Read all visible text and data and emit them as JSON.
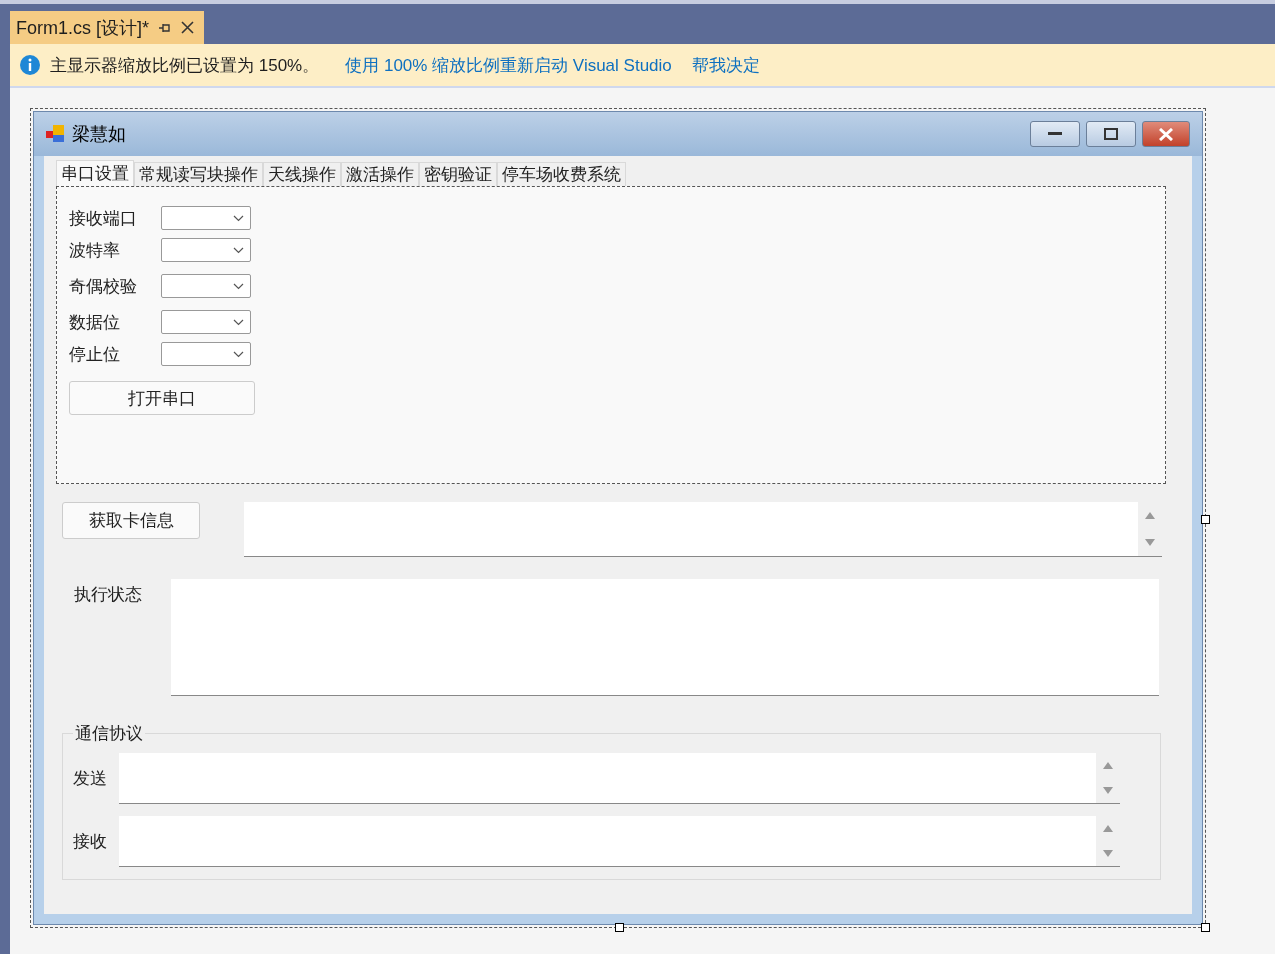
{
  "document_tab": {
    "title": "Form1.cs [设计]*"
  },
  "info_bar": {
    "message": "主显示器缩放比例已设置为 150%。",
    "links": [
      "使用 100% 缩放比例重新启动 Visual Studio",
      "帮我决定"
    ]
  },
  "form": {
    "title": "梁慧如",
    "tabs": [
      {
        "label": "串口设置",
        "selected": true
      },
      {
        "label": "常规读写块操作",
        "selected": false
      },
      {
        "label": "天线操作",
        "selected": false
      },
      {
        "label": "激活操作",
        "selected": false
      },
      {
        "label": "密钥验证",
        "selected": false
      },
      {
        "label": "停车场收费系统",
        "selected": false
      }
    ],
    "serial_fields": [
      {
        "label": "接收端口"
      },
      {
        "label": "波特率"
      },
      {
        "label": "奇偶校验"
      },
      {
        "label": "数据位"
      },
      {
        "label": "停止位"
      }
    ],
    "open_button": "打开串口",
    "card_button": "获取卡信息",
    "status_label": "执行状态",
    "protocol": {
      "title": "通信协议",
      "rows": [
        {
          "label": "发送"
        },
        {
          "label": "接收"
        }
      ]
    }
  }
}
